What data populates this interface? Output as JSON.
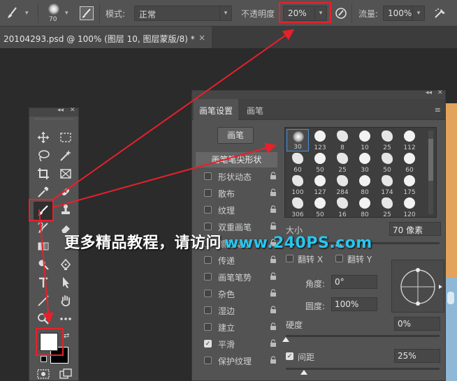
{
  "options_bar": {
    "brush_size": "70",
    "mode_label": "模式:",
    "mode_value": "正常",
    "opacity_label": "不透明度",
    "opacity_value": "20%",
    "flow_label": "流量:",
    "flow_value": "100%"
  },
  "document": {
    "tab_title": "20104293.psd @ 100% (图层 10, 图层蒙版/8) *",
    "close": "×"
  },
  "brush_panel": {
    "tab_settings": "画笔设置",
    "tab_brushes": "画笔",
    "brushes_button": "画笔",
    "tip_shape": "画笔笔尖形状",
    "options": [
      {
        "label": "形状动态",
        "checked": false
      },
      {
        "label": "散布",
        "checked": false
      },
      {
        "label": "纹理",
        "checked": false
      },
      {
        "label": "双重画笔",
        "checked": false
      },
      {
        "label": "颜色动态",
        "checked": false
      },
      {
        "label": "传递",
        "checked": false
      },
      {
        "label": "画笔笔势",
        "checked": false
      },
      {
        "label": "杂色",
        "checked": false
      },
      {
        "label": "湿边",
        "checked": false
      },
      {
        "label": "建立",
        "checked": false
      },
      {
        "label": "平滑",
        "checked": true
      },
      {
        "label": "保护纹理",
        "checked": false
      }
    ],
    "presets": [
      "30",
      "123",
      "8",
      "10",
      "25",
      "112",
      "60",
      "50",
      "25",
      "30",
      "50",
      "60",
      "100",
      "127",
      "284",
      "80",
      "174",
      "175",
      "306",
      "50",
      "16",
      "80",
      "25",
      "120"
    ],
    "size_label": "大小",
    "size_value": "70 像素",
    "flip_x": "翻转 X",
    "flip_y": "翻转 Y",
    "angle_label": "角度:",
    "angle_value": "0°",
    "roundness_label": "圆度:",
    "roundness_value": "100%",
    "hardness_label": "硬度",
    "hardness_value": "0%",
    "spacing_label": "间距",
    "spacing_value": "25%"
  },
  "watermark": {
    "cn": "更多精品教程，请访问",
    "url": "www.240PS.com"
  },
  "colors": {
    "highlight": "#e8202a",
    "watermark_url": "#29c6ef",
    "panel_bg": "#535353"
  }
}
